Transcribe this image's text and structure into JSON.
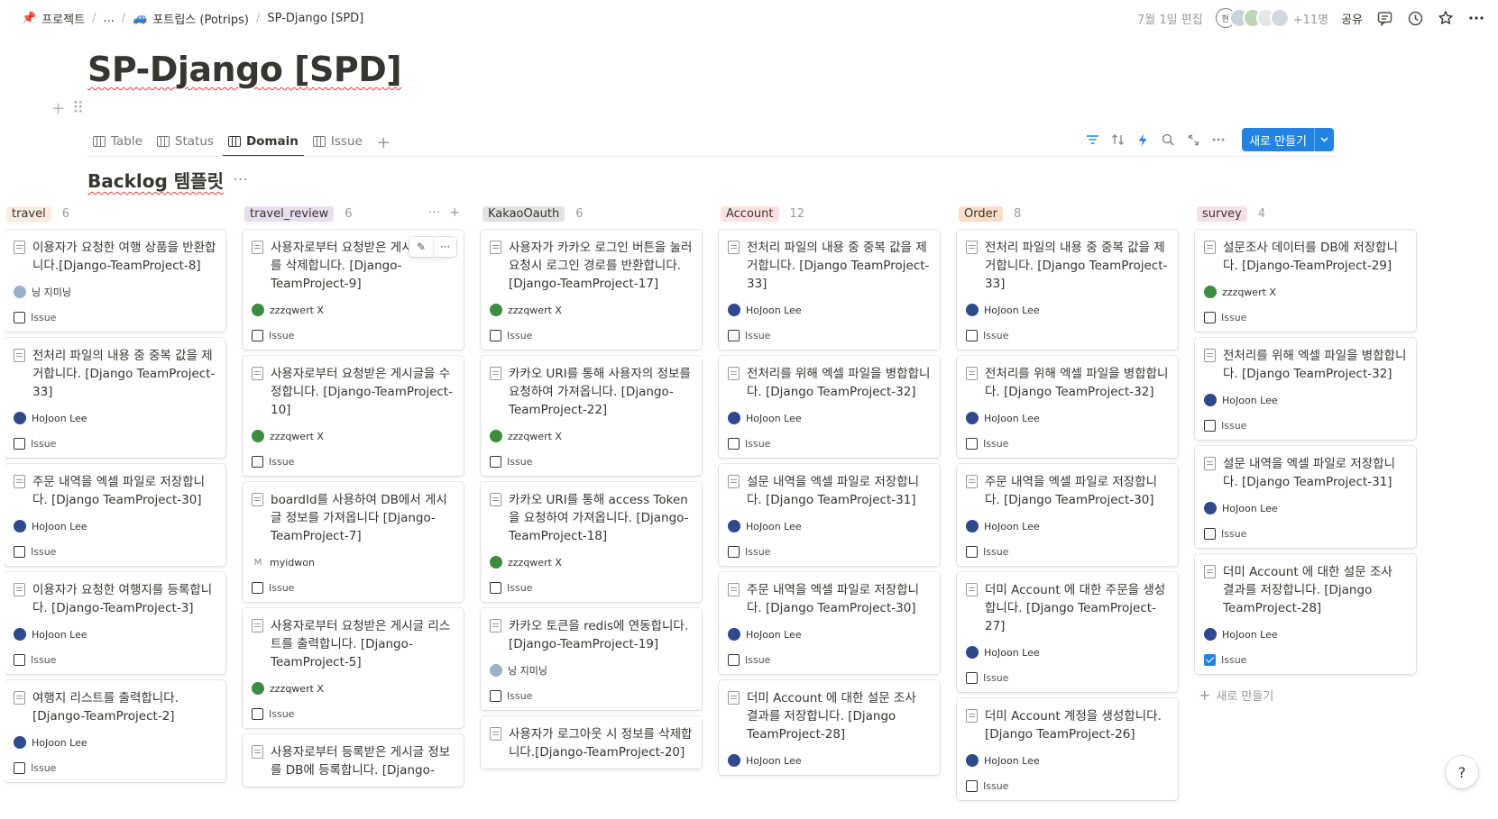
{
  "breadcrumb": {
    "project": "프로젝트",
    "ellipsis": "...",
    "workspace": "포트립스 (Potrips)",
    "page": "SP-Django [SPD]"
  },
  "topbar": {
    "edited": "7월 1일 편집",
    "avatar_initial": "현",
    "extra_count": "+11명",
    "share": "공유"
  },
  "title": "SP-Django [SPD]",
  "views": {
    "tabs": [
      {
        "label": "Table"
      },
      {
        "label": "Status"
      },
      {
        "label": "Domain",
        "active": true
      },
      {
        "label": "Issue"
      }
    ],
    "new_button": "새로 만들기"
  },
  "database_title": "Backlog 템플릿",
  "board": {
    "columns": [
      {
        "name": "travel",
        "count": "6",
        "color": "#fbecdd",
        "cards": [
          {
            "title": "이용자가 요청한 여행 상품을 반환합니다.[Django-TeamProject-8]",
            "person": "닝 지미닝",
            "avatar": "jimin",
            "prop": "Issue",
            "checked": false
          },
          {
            "title": "전처리 파일의 내용 중 중복 값을 제거합니다. [Django TeamProject-33]",
            "person": "HoJoon Lee",
            "avatar": "hojoon",
            "prop": "Issue",
            "checked": false
          },
          {
            "title": "주문 내역을 엑셀 파일로 저장합니다. [Django TeamProject-30]",
            "person": "HoJoon Lee",
            "avatar": "hojoon",
            "prop": "Issue",
            "checked": false
          },
          {
            "title": "이용자가 요청한 여행지를 등록합니다. [Django-TeamProject-3]",
            "person": "HoJoon Lee",
            "avatar": "hojoon",
            "prop": "Issue",
            "checked": false
          },
          {
            "title": "여행지 리스트를 출력합니다. [Django-TeamProject-2]",
            "person": "HoJoon Lee",
            "avatar": "hojoon",
            "prop": "Issue",
            "checked": false
          }
        ]
      },
      {
        "name": "travel_review",
        "count": "6",
        "color": "#e8deee",
        "cards": [
          {
            "title": "사용자로부터 요청받은 게시글 정보를 삭제합니다. [Django-TeamProject-9]",
            "person": "zzzqwert X",
            "avatar": "zzz",
            "prop": "Issue",
            "checked": false,
            "hover": true
          },
          {
            "title": "사용자로부터 요청받은 게시글을 수정합니다. [Django-TeamProject-10]",
            "person": "zzzqwert X",
            "avatar": "zzz",
            "prop": "Issue",
            "checked": false
          },
          {
            "title": "boardId를 사용하여 DB에서 게시글 정보를 가져옵니다 [Django-TeamProject-7]",
            "person": "myidwon",
            "avatar": "myid",
            "prop": "Issue",
            "checked": false
          },
          {
            "title": "사용자로부터 요청받은 게시글 리스트를 출력합니다. [Django-TeamProject-5]",
            "person": "zzzqwert X",
            "avatar": "zzz",
            "prop": "Issue",
            "checked": false
          },
          {
            "title": "사용자로부터 등록받은 게시글 정보를 DB에 등록합니다. [Django-",
            "person": "",
            "avatar": "",
            "prop": "",
            "checked": false
          }
        ]
      },
      {
        "name": "KakaoOauth",
        "count": "6",
        "color": "#e3e2e0",
        "cards": [
          {
            "title": "사용자가 카카오 로그인 버튼을 눌러 요청시 로그인 경로를 반환합니다. [Django-TeamProject-17]",
            "person": "zzzqwert X",
            "avatar": "zzz",
            "prop": "Issue",
            "checked": false
          },
          {
            "title": "카카오 URI를 통해 사용자의 정보를 요청하여 가져옵니다. [Django-TeamProject-22]",
            "person": "zzzqwert X",
            "avatar": "zzz",
            "prop": "Issue",
            "checked": false
          },
          {
            "title": "카카오 URI를 통해 access Token을 요청하여 가져옵니다. [Django-TeamProject-18]",
            "person": "zzzqwert X",
            "avatar": "zzz",
            "prop": "Issue",
            "checked": false
          },
          {
            "title": "카카오 토큰을 redis에 연동합니다.[Django-TeamProject-19]",
            "person": "닝 지미닝",
            "avatar": "jimin",
            "prop": "Issue",
            "checked": false
          },
          {
            "title": "사용자가 로그아웃 시 정보를 삭제합니다.[Django-TeamProject-20]",
            "person": "",
            "avatar": "",
            "prop": "",
            "checked": false
          }
        ]
      },
      {
        "name": "Account",
        "count": "12",
        "color": "#ffe2dd",
        "cards": [
          {
            "title": "전처리 파일의 내용 중 중복 값을 제거합니다. [Django TeamProject-33]",
            "person": "HoJoon Lee",
            "avatar": "hojoon",
            "prop": "Issue",
            "checked": false
          },
          {
            "title": "전처리를 위해 엑셀 파일을 병합합니다. [Django TeamProject-32]",
            "person": "HoJoon Lee",
            "avatar": "hojoon",
            "prop": "Issue",
            "checked": false
          },
          {
            "title": "설문 내역을 엑셀 파일로 저장합니다. [Django TeamProject-31]",
            "person": "HoJoon Lee",
            "avatar": "hojoon",
            "prop": "Issue",
            "checked": false
          },
          {
            "title": "주문 내역을 엑셀 파일로 저장합니다. [Django TeamProject-30]",
            "person": "HoJoon Lee",
            "avatar": "hojoon",
            "prop": "Issue",
            "checked": false
          },
          {
            "title": "더미 Account 에 대한 설문 조사 결과를 저장합니다. [Django TeamProject-28]",
            "person": "HoJoon Lee",
            "avatar": "hojoon",
            "prop": "",
            "checked": false
          }
        ]
      },
      {
        "name": "Order",
        "count": "8",
        "color": "#fadec9",
        "cards": [
          {
            "title": "전처리 파일의 내용 중 중복 값을 제거합니다. [Django TeamProject-33]",
            "person": "HoJoon Lee",
            "avatar": "hojoon",
            "prop": "Issue",
            "checked": false
          },
          {
            "title": "전처리를 위해 엑셀 파일을 병합합니다. [Django TeamProject-32]",
            "person": "HoJoon Lee",
            "avatar": "hojoon",
            "prop": "Issue",
            "checked": false
          },
          {
            "title": "주문 내역을 엑셀 파일로 저장합니다. [Django TeamProject-30]",
            "person": "HoJoon Lee",
            "avatar": "hojoon",
            "prop": "Issue",
            "checked": false
          },
          {
            "title": "더미 Account 에 대한 주문을 생성합니다. [Django TeamProject-27]",
            "person": "HoJoon Lee",
            "avatar": "hojoon",
            "prop": "Issue",
            "checked": false
          },
          {
            "title": "더미 Account 계정을 생성합니다. [Django TeamProject-26]",
            "person": "HoJoon Lee",
            "avatar": "hojoon",
            "prop": "Issue",
            "checked": false
          }
        ]
      },
      {
        "name": "survey",
        "count": "4",
        "color": "#f5e0e9",
        "cards": [
          {
            "title": "설문조사 데이터를 DB에 저장합니다. [Django-TeamProject-29]",
            "person": "zzzqwert X",
            "avatar": "zzz",
            "prop": "Issue",
            "checked": false
          },
          {
            "title": "전처리를 위해 엑셀 파일을 병합합니다. [Django TeamProject-32]",
            "person": "HoJoon Lee",
            "avatar": "hojoon",
            "prop": "Issue",
            "checked": false
          },
          {
            "title": "설문 내역을 엑셀 파일로 저장합니다. [Django TeamProject-31]",
            "person": "HoJoon Lee",
            "avatar": "hojoon",
            "prop": "Issue",
            "checked": false
          },
          {
            "title": "더미 Account 에 대한 설문 조사 결과를 저장합니다. [Django TeamProject-28]",
            "person": "HoJoon Lee",
            "avatar": "hojoon",
            "prop": "Issue",
            "checked": true
          }
        ],
        "new_label": "새로 만들기"
      }
    ]
  },
  "help": "?"
}
